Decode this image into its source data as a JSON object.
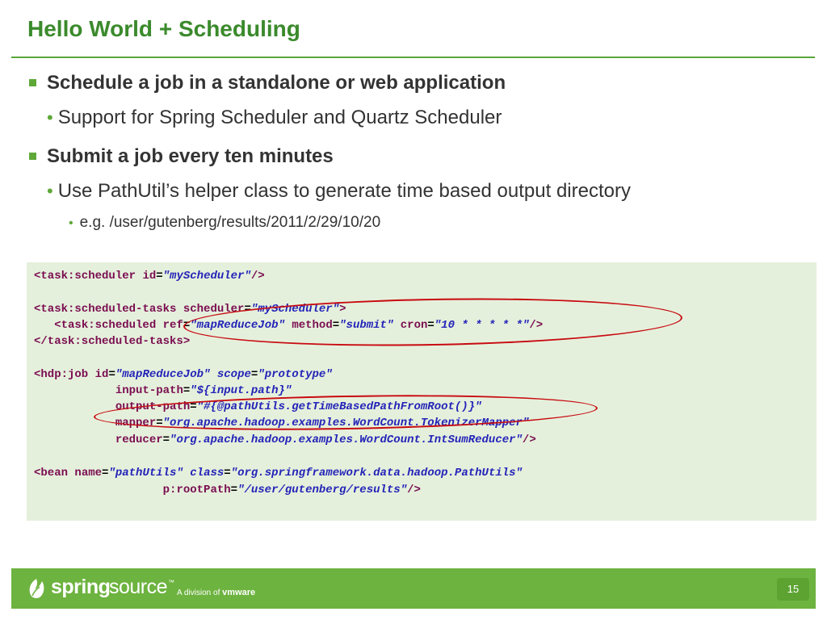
{
  "slide": {
    "title": "Hello World + Scheduling",
    "page_number": "15"
  },
  "bullets": [
    {
      "text": "Schedule a job in a standalone or web application"
    },
    {
      "text": "Support for Spring Scheduler and Quartz Scheduler"
    },
    {
      "text": "Submit a job every ten minutes"
    },
    {
      "text": "Use PathUtil’s helper class to generate time based output directory"
    },
    {
      "text": "e.g. /user/gutenberg/results/2011/2/29/10/20"
    }
  ],
  "code": {
    "l1": {
      "tag": "<task:scheduler",
      "a1": "id",
      "v1": "\"myScheduler\"",
      "end": "/>"
    },
    "l2": {
      "tag": "<task:scheduled-tasks",
      "a1": "scheduler",
      "v1": "\"myScheduler\"",
      "end": ">"
    },
    "l3": {
      "tag": "<task:scheduled",
      "a1": "ref",
      "v1": "\"mapReduceJob\"",
      "a2": "method",
      "v2": "\"submit\"",
      "a3": "cron",
      "v3": "\"10 * * * * *\"",
      "end": "/>"
    },
    "l4": {
      "tag": "</task:scheduled-tasks>"
    },
    "l5": {
      "tag": "<hdp:job",
      "a1": "id",
      "v1": "\"mapReduceJob\"",
      "a2": "scope",
      "v2": "\"prototype\""
    },
    "l6": {
      "a1": "input-path",
      "v1": "\"${input.path}\""
    },
    "l7": {
      "a1": "output-path",
      "v1": "\"#{@pathUtils.getTimeBasedPathFromRoot()}\""
    },
    "l8": {
      "a1": "mapper",
      "v1": "\"org.apache.hadoop.examples.WordCount.TokenizerMapper\""
    },
    "l9": {
      "a1": "reducer",
      "v1": "\"org.apache.hadoop.examples.WordCount.IntSumReducer\"",
      "end": "/>"
    },
    "l10": {
      "tag": "<bean",
      "a1": "name",
      "v1": "\"pathUtils\"",
      "a2": "class",
      "v2": "\"org.springframework.data.hadoop.PathUtils\""
    },
    "l11": {
      "a1": "p:rootPath",
      "v1": "\"/user/gutenberg/results\"",
      "end": "/>"
    },
    "eq": "="
  },
  "footer": {
    "brand_spring": "spring",
    "brand_source": "source",
    "trademark": "™",
    "division_prefix": "A division of",
    "division_brand": "vmware"
  },
  "colors": {
    "title": "#3b8a2c",
    "bullet_marker": "#5ea838",
    "code_background": "#e5f0dc",
    "code_tag": "#7a0d50",
    "code_value": "#2424b8",
    "highlight_ellipse": "#c80a10",
    "footer_background": "#6db33f"
  }
}
